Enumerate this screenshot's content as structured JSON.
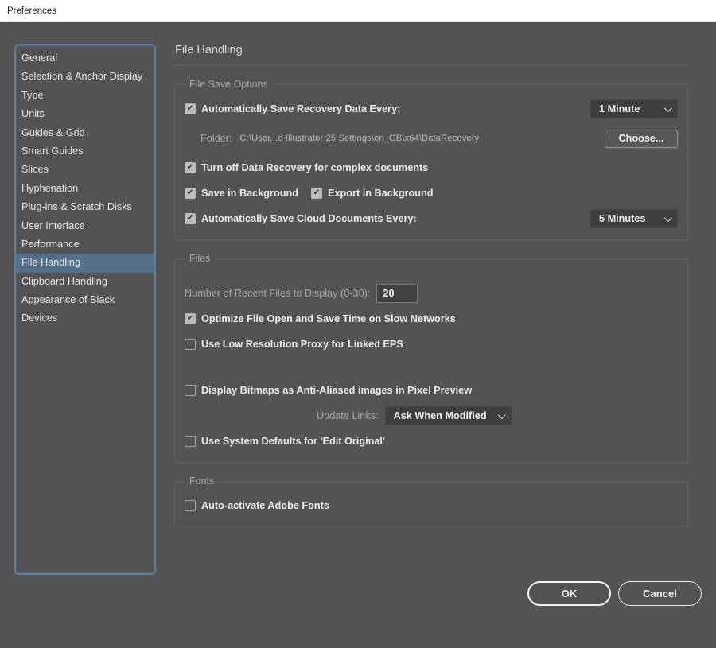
{
  "window": {
    "title": "Preferences"
  },
  "colors": {
    "dialog_bg": "#535353",
    "titlebar_bg": "#ffffff",
    "sidebar_border": "#5b7fa1",
    "selected_item_bg": "#53708b",
    "control_bg": "#3e3e3e",
    "text_primary": "#ececec",
    "text_dim": "#a8a8a8"
  },
  "sidebar": {
    "items": [
      {
        "label": "General",
        "selected": false
      },
      {
        "label": "Selection & Anchor Display",
        "selected": false
      },
      {
        "label": "Type",
        "selected": false
      },
      {
        "label": "Units",
        "selected": false
      },
      {
        "label": "Guides & Grid",
        "selected": false
      },
      {
        "label": "Smart Guides",
        "selected": false
      },
      {
        "label": "Slices",
        "selected": false
      },
      {
        "label": "Hyphenation",
        "selected": false
      },
      {
        "label": "Plug-ins & Scratch Disks",
        "selected": false
      },
      {
        "label": "User Interface",
        "selected": false
      },
      {
        "label": "Performance",
        "selected": false
      },
      {
        "label": "File Handling",
        "selected": true
      },
      {
        "label": "Clipboard Handling",
        "selected": false
      },
      {
        "label": "Appearance of Black",
        "selected": false
      },
      {
        "label": "Devices",
        "selected": false
      }
    ]
  },
  "main": {
    "title": "File Handling",
    "groups": {
      "file_save_options": {
        "title": "File Save Options",
        "auto_save_recovery": {
          "label": "Automatically Save Recovery Data Every:",
          "checked": true,
          "value": "1 Minute"
        },
        "folder": {
          "label": "Folder:",
          "path": "C:\\User...e Illustrator 25 Settings\\en_GB\\x64\\DataRecovery",
          "button_label": "Choose..."
        },
        "turn_off_recovery": {
          "label": "Turn off Data Recovery for complex documents",
          "checked": true
        },
        "save_in_background": {
          "label": "Save in Background",
          "checked": true
        },
        "export_in_background": {
          "label": "Export in Background",
          "checked": true
        },
        "auto_save_cloud": {
          "label": "Automatically Save Cloud Documents Every:",
          "checked": true,
          "value": "5 Minutes"
        }
      },
      "files": {
        "title": "Files",
        "recent_files": {
          "label": "Number of Recent Files to Display (0-30):",
          "value": "20"
        },
        "optimize_network": {
          "label": "Optimize File Open and Save Time on Slow Networks",
          "checked": true
        },
        "low_res_proxy": {
          "label": "Use Low Resolution Proxy for Linked EPS",
          "checked": false
        },
        "display_bitmaps": {
          "label": "Display Bitmaps as Anti-Aliased images in Pixel Preview",
          "checked": false
        },
        "update_links": {
          "label": "Update Links:",
          "value": "Ask When Modified"
        },
        "system_defaults": {
          "label": "Use System Defaults for 'Edit Original'",
          "checked": false
        }
      },
      "fonts": {
        "title": "Fonts",
        "auto_activate": {
          "label": "Auto-activate Adobe Fonts",
          "checked": false
        }
      }
    },
    "buttons": {
      "ok": "OK",
      "cancel": "Cancel"
    }
  }
}
